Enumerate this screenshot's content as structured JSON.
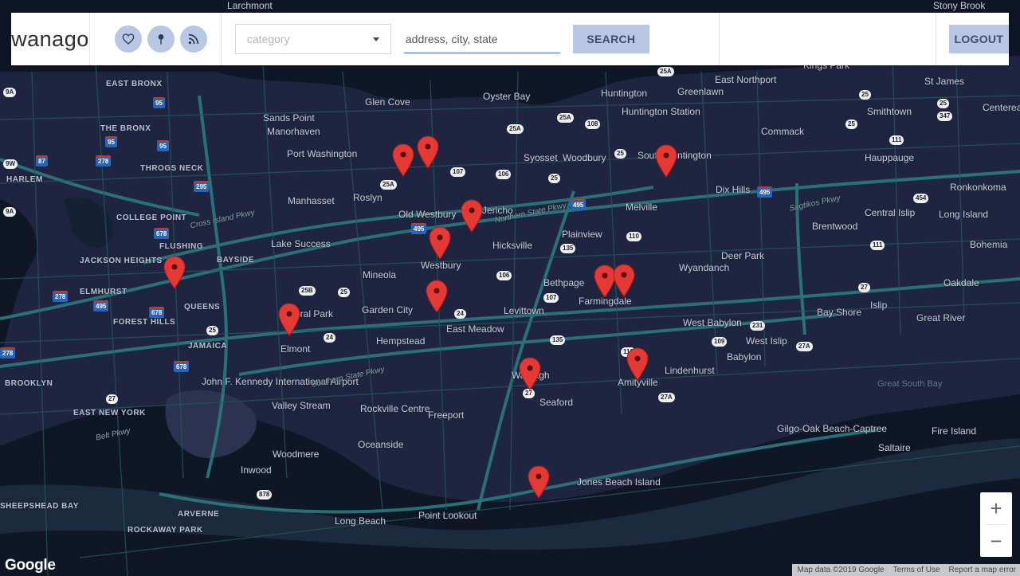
{
  "header": {
    "logo": "wanago",
    "icons": [
      "heart-icon",
      "pin-icon",
      "rss-icon"
    ],
    "category_placeholder": "category",
    "address_placeholder": "address, city, state",
    "search_label": "SEARCH",
    "logout_label": "LOGOUT"
  },
  "map": {
    "places": [
      {
        "t": "Glen Cove",
        "c": ""
      },
      {
        "t": "Oyster Bay",
        "c": ""
      },
      {
        "t": "Huntington",
        "c": ""
      },
      {
        "t": "Huntington Station",
        "c": ""
      },
      {
        "t": "East Northport",
        "c": ""
      },
      {
        "t": "Greenlawn",
        "c": ""
      },
      {
        "t": "St James",
        "c": ""
      },
      {
        "t": "Smithtown",
        "c": ""
      },
      {
        "t": "Centereach",
        "c": ""
      },
      {
        "t": "Kings Park",
        "c": ""
      },
      {
        "t": "Stony Brook",
        "c": ""
      },
      {
        "t": "Larchmont",
        "c": ""
      },
      {
        "t": "Sands Point",
        "c": ""
      },
      {
        "t": "Manorhaven",
        "c": ""
      },
      {
        "t": "Port Washington",
        "c": ""
      },
      {
        "t": "Manhasset",
        "c": ""
      },
      {
        "t": "Roslyn",
        "c": ""
      },
      {
        "t": "Syosset",
        "c": ""
      },
      {
        "t": "Woodbury",
        "c": ""
      },
      {
        "t": "Commack",
        "c": ""
      },
      {
        "t": "Hauppauge",
        "c": ""
      },
      {
        "t": "South Huntington",
        "c": ""
      },
      {
        "t": "Dix Hills",
        "c": ""
      },
      {
        "t": "Melville",
        "c": ""
      },
      {
        "t": "Ronkonkoma",
        "c": ""
      },
      {
        "t": "Central Islip",
        "c": ""
      },
      {
        "t": "Long Island",
        "c": ""
      },
      {
        "t": "Brentwood",
        "c": ""
      },
      {
        "t": "Bohemia",
        "c": ""
      },
      {
        "t": "Old Westbury",
        "c": ""
      },
      {
        "t": "Jericho",
        "c": ""
      },
      {
        "t": "Plainview",
        "c": ""
      },
      {
        "t": "Lake Success",
        "c": ""
      },
      {
        "t": "Hicksville",
        "c": ""
      },
      {
        "t": "Westbury",
        "c": ""
      },
      {
        "t": "Deer Park",
        "c": ""
      },
      {
        "t": "Wyandanch",
        "c": ""
      },
      {
        "t": "Mineola",
        "c": ""
      },
      {
        "t": "Bethpage",
        "c": ""
      },
      {
        "t": "Farmingdale",
        "c": ""
      },
      {
        "t": "Oakdale",
        "c": ""
      },
      {
        "t": "Islip",
        "c": ""
      },
      {
        "t": "Bay Shore",
        "c": ""
      },
      {
        "t": "Great River",
        "c": ""
      },
      {
        "t": "Floral Park",
        "c": ""
      },
      {
        "t": "Garden City",
        "c": ""
      },
      {
        "t": "Levittown",
        "c": ""
      },
      {
        "t": "West Babylon",
        "c": ""
      },
      {
        "t": "East Meadow",
        "c": ""
      },
      {
        "t": "West Islip",
        "c": ""
      },
      {
        "t": "Babylon",
        "c": ""
      },
      {
        "t": "Elmont",
        "c": ""
      },
      {
        "t": "Hempstead",
        "c": ""
      },
      {
        "t": "Lindenhurst",
        "c": ""
      },
      {
        "t": "Wantagh",
        "c": ""
      },
      {
        "t": "Amityville",
        "c": ""
      },
      {
        "t": "Seaford",
        "c": ""
      },
      {
        "t": "Valley Stream",
        "c": ""
      },
      {
        "t": "Rockville Centre",
        "c": ""
      },
      {
        "t": "Freeport",
        "c": ""
      },
      {
        "t": "Gilgo-Oak Beach-Captree",
        "c": ""
      },
      {
        "t": "Fire Island",
        "c": ""
      },
      {
        "t": "Saltaire",
        "c": ""
      },
      {
        "t": "Oceanside",
        "c": ""
      },
      {
        "t": "Woodmere",
        "c": ""
      },
      {
        "t": "Inwood",
        "c": ""
      },
      {
        "t": "Jones Beach Island",
        "c": ""
      },
      {
        "t": "Long Beach",
        "c": ""
      },
      {
        "t": "Point Lookout",
        "c": ""
      },
      {
        "t": "John F. Kennedy International Airport",
        "c": ""
      },
      {
        "t": "QUEENS",
        "c": "caps"
      },
      {
        "t": "JAMAICA",
        "c": "caps"
      },
      {
        "t": "BROOKLYN",
        "c": "caps"
      },
      {
        "t": "EAST NEW YORK",
        "c": "caps"
      },
      {
        "t": "FOREST HILLS",
        "c": "caps"
      },
      {
        "t": "ELMHURST",
        "c": "caps"
      },
      {
        "t": "JACKSON HEIGHTS",
        "c": "caps"
      },
      {
        "t": "FLUSHING",
        "c": "caps"
      },
      {
        "t": "BAYSIDE",
        "c": "caps"
      },
      {
        "t": "COLLEGE POINT",
        "c": "caps"
      },
      {
        "t": "THROGS NECK",
        "c": "caps"
      },
      {
        "t": "THE BRONX",
        "c": "caps"
      },
      {
        "t": "EAST BRONX",
        "c": "caps"
      },
      {
        "t": "HARLEM",
        "c": "caps"
      },
      {
        "t": "SHEEPSHEAD BAY",
        "c": "caps"
      },
      {
        "t": "ARVERNE",
        "c": "caps"
      },
      {
        "t": "ROCKAWAY PARK",
        "c": "caps"
      },
      {
        "t": "Great South Bay",
        "c": "water"
      },
      {
        "t": "Northern State Pkwy",
        "c": "italic"
      },
      {
        "t": "Southern State Pkwy",
        "c": "italic"
      },
      {
        "t": "Cross Island Pkwy",
        "c": "italic"
      },
      {
        "t": "Belt Pkwy",
        "c": "italic"
      },
      {
        "t": "Sagtikos Pkwy",
        "c": "italic"
      }
    ],
    "shields": [
      {
        "t": "25A",
        "i": false
      },
      {
        "t": "25A",
        "i": false
      },
      {
        "t": "25A",
        "i": false
      },
      {
        "t": "25A",
        "i": false
      },
      {
        "t": "108",
        "i": false
      },
      {
        "t": "25",
        "i": false
      },
      {
        "t": "25",
        "i": false
      },
      {
        "t": "347",
        "i": false
      },
      {
        "t": "25",
        "i": false
      },
      {
        "t": "111",
        "i": false
      },
      {
        "t": "107",
        "i": false
      },
      {
        "t": "106",
        "i": false
      },
      {
        "t": "25",
        "i": false
      },
      {
        "t": "25",
        "i": false
      },
      {
        "t": "495",
        "i": true
      },
      {
        "t": "495",
        "i": true
      },
      {
        "t": "495",
        "i": true
      },
      {
        "t": "454",
        "i": false
      },
      {
        "t": "110",
        "i": false
      },
      {
        "t": "135",
        "i": false
      },
      {
        "t": "111",
        "i": false
      },
      {
        "t": "106",
        "i": false
      },
      {
        "t": "107",
        "i": false
      },
      {
        "t": "27",
        "i": false
      },
      {
        "t": "25B",
        "i": false
      },
      {
        "t": "25",
        "i": false
      },
      {
        "t": "24",
        "i": false
      },
      {
        "t": "24",
        "i": false
      },
      {
        "t": "135",
        "i": false
      },
      {
        "t": "231",
        "i": false
      },
      {
        "t": "109",
        "i": false
      },
      {
        "t": "27A",
        "i": false
      },
      {
        "t": "110",
        "i": false
      },
      {
        "t": "27",
        "i": false
      },
      {
        "t": "27A",
        "i": false
      },
      {
        "t": "27",
        "i": false
      },
      {
        "t": "878",
        "i": false
      },
      {
        "t": "95",
        "i": true
      },
      {
        "t": "95",
        "i": true
      },
      {
        "t": "95",
        "i": true
      },
      {
        "t": "87",
        "i": true
      },
      {
        "t": "278",
        "i": true
      },
      {
        "t": "295",
        "i": true
      },
      {
        "t": "678",
        "i": true
      },
      {
        "t": "678",
        "i": true
      },
      {
        "t": "678",
        "i": true
      },
      {
        "t": "278",
        "i": true
      },
      {
        "t": "495",
        "i": true
      },
      {
        "t": "25",
        "i": false
      },
      {
        "t": "278",
        "i": true
      },
      {
        "t": "9A",
        "i": false
      },
      {
        "t": "9W",
        "i": false
      },
      {
        "t": "9A",
        "i": false
      }
    ],
    "marker_count": 15,
    "zoom_in": "+",
    "zoom_out": "−",
    "google_logo": "Google",
    "attribution": [
      "Map data ©2019 Google",
      "Terms of Use",
      "Report a map error"
    ]
  },
  "colors": {
    "land": "#1f2540",
    "water": "#0e1626",
    "road": "#2c7a7e",
    "marker": "#e53935",
    "button": "#b8c7e4"
  }
}
